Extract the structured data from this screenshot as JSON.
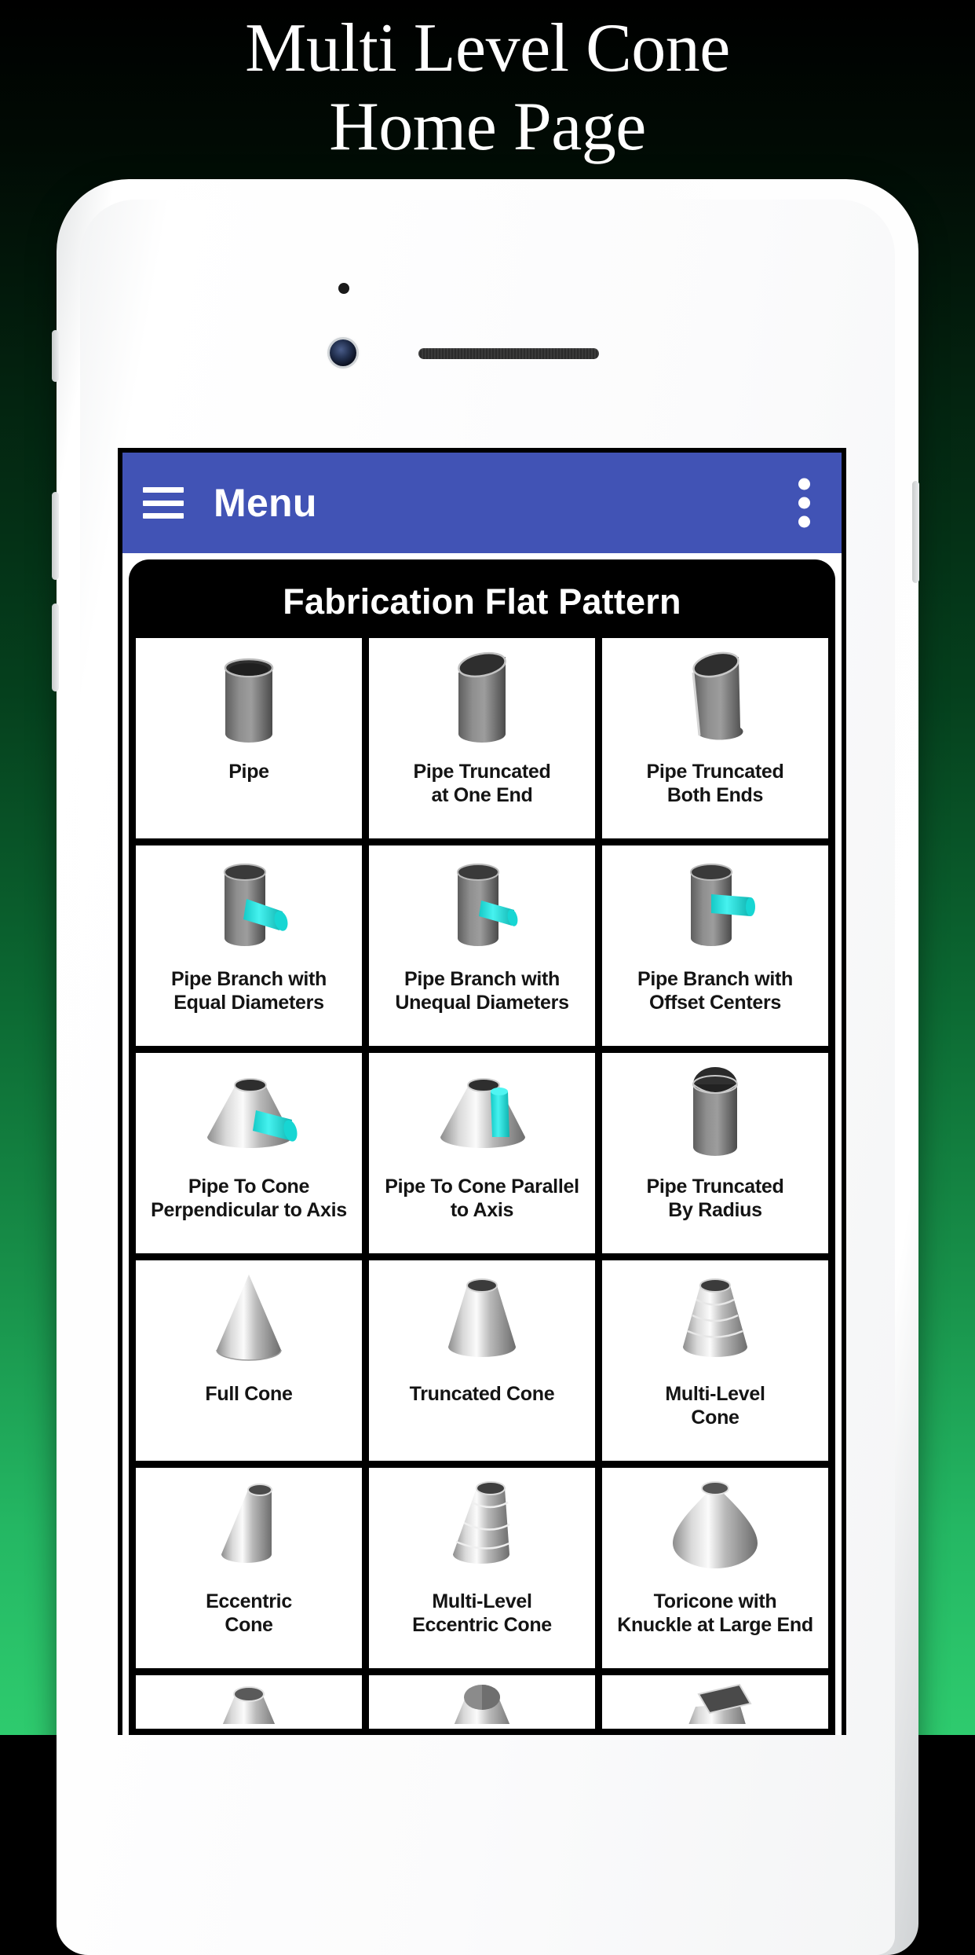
{
  "promo": {
    "line1": "Multi Level Cone",
    "line2": "Home Page"
  },
  "colors": {
    "appbar_blue": "#4153B5",
    "panel_black": "#000000",
    "branch_teal": "#2BE0DC",
    "bg_green": "#2ECB6E"
  },
  "device": {
    "frame": "white-phone-frame",
    "camera": "front-camera",
    "speaker": "earpiece-speaker"
  },
  "appbar": {
    "menu_icon": "hamburger-icon",
    "title": "Menu",
    "overflow_icon": "more-vertical-icon"
  },
  "panel": {
    "title": "Fabrication Flat Pattern"
  },
  "grid": {
    "rows": [
      {
        "cells": [
          {
            "label": "Pipe",
            "icon": "cylinder-pipe-icon"
          },
          {
            "label": "Pipe Truncated\nat One End",
            "icon": "pipe-truncated-one-end-icon"
          },
          {
            "label": "Pipe Truncated\nBoth Ends",
            "icon": "pipe-truncated-both-ends-icon"
          }
        ]
      },
      {
        "cells": [
          {
            "label": "Pipe Branch with\nEqual Diameters",
            "icon": "pipe-branch-equal-icon"
          },
          {
            "label": "Pipe Branch with\nUnequal Diameters",
            "icon": "pipe-branch-unequal-icon"
          },
          {
            "label": "Pipe Branch with\nOffset Centers",
            "icon": "pipe-branch-offset-icon"
          }
        ]
      },
      {
        "cells": [
          {
            "label": "Pipe To Cone\nPerpendicular to Axis",
            "icon": "pipe-to-cone-perpendicular-icon"
          },
          {
            "label": "Pipe To Cone Parallel\nto Axis",
            "icon": "pipe-to-cone-parallel-icon"
          },
          {
            "label": "Pipe Truncated\nBy Radius",
            "icon": "pipe-truncated-radius-icon"
          }
        ]
      },
      {
        "cells": [
          {
            "label": "Full Cone",
            "icon": "full-cone-icon"
          },
          {
            "label": "Truncated Cone",
            "icon": "truncated-cone-icon"
          },
          {
            "label": "Multi-Level\nCone",
            "icon": "multi-level-cone-icon"
          }
        ]
      },
      {
        "cells": [
          {
            "label": "Eccentric\nCone",
            "icon": "eccentric-cone-icon"
          },
          {
            "label": "Multi-Level\nEccentric Cone",
            "icon": "multi-level-eccentric-cone-icon"
          },
          {
            "label": "Toricone with\nKnuckle at Large End",
            "icon": "toricone-knuckle-icon"
          }
        ]
      },
      {
        "clipped": true,
        "cells": [
          {
            "label": "",
            "icon": "reducer-offset-icon"
          },
          {
            "label": "",
            "icon": "reducer-round-icon"
          },
          {
            "label": "",
            "icon": "square-to-round-icon"
          }
        ]
      }
    ]
  }
}
